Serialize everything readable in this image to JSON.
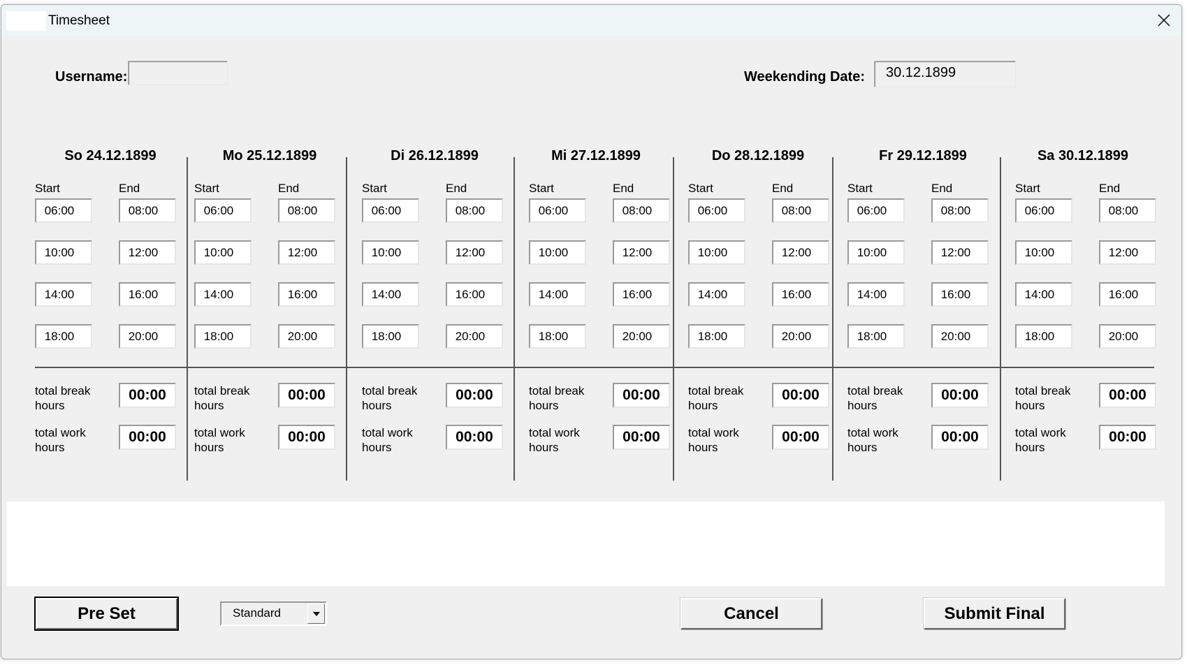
{
  "window": {
    "title": "Timesheet"
  },
  "header": {
    "username_label": "Username:",
    "username_value": "",
    "weekending_label": "Weekending Date:",
    "weekending_value": "30.12.1899"
  },
  "labels": {
    "start": "Start",
    "end": "End",
    "total_break": "total break hours",
    "total_work": "total work hours"
  },
  "days": [
    {
      "title": "So 24.12.1899",
      "starts": [
        "06:00",
        "10:00",
        "14:00",
        "18:00"
      ],
      "ends": [
        "08:00",
        "12:00",
        "16:00",
        "20:00"
      ],
      "total_break": "00:00",
      "total_work": "00:00"
    },
    {
      "title": "Mo 25.12.1899",
      "starts": [
        "06:00",
        "10:00",
        "14:00",
        "18:00"
      ],
      "ends": [
        "08:00",
        "12:00",
        "16:00",
        "20:00"
      ],
      "total_break": "00:00",
      "total_work": "00:00"
    },
    {
      "title": "Di 26.12.1899",
      "starts": [
        "06:00",
        "10:00",
        "14:00",
        "18:00"
      ],
      "ends": [
        "08:00",
        "12:00",
        "16:00",
        "20:00"
      ],
      "total_break": "00:00",
      "total_work": "00:00"
    },
    {
      "title": "Mi 27.12.1899",
      "starts": [
        "06:00",
        "10:00",
        "14:00",
        "18:00"
      ],
      "ends": [
        "08:00",
        "12:00",
        "16:00",
        "20:00"
      ],
      "total_break": "00:00",
      "total_work": "00:00"
    },
    {
      "title": "Do 28.12.1899",
      "starts": [
        "06:00",
        "10:00",
        "14:00",
        "18:00"
      ],
      "ends": [
        "08:00",
        "12:00",
        "16:00",
        "20:00"
      ],
      "total_break": "00:00",
      "total_work": "00:00"
    },
    {
      "title": "Fr 29.12.1899",
      "starts": [
        "06:00",
        "10:00",
        "14:00",
        "18:00"
      ],
      "ends": [
        "08:00",
        "12:00",
        "16:00",
        "20:00"
      ],
      "total_break": "00:00",
      "total_work": "00:00"
    },
    {
      "title": "Sa 30.12.1899",
      "starts": [
        "06:00",
        "10:00",
        "14:00",
        "18:00"
      ],
      "ends": [
        "08:00",
        "12:00",
        "16:00",
        "20:00"
      ],
      "total_break": "00:00",
      "total_work": "00:00"
    }
  ],
  "footer": {
    "preset_label": "Pre Set",
    "preset_select_value": "Standard",
    "cancel_label": "Cancel",
    "submit_label": "Submit Final"
  },
  "icons": {
    "close": "close-icon",
    "dropdown": "chevron-down-icon"
  }
}
